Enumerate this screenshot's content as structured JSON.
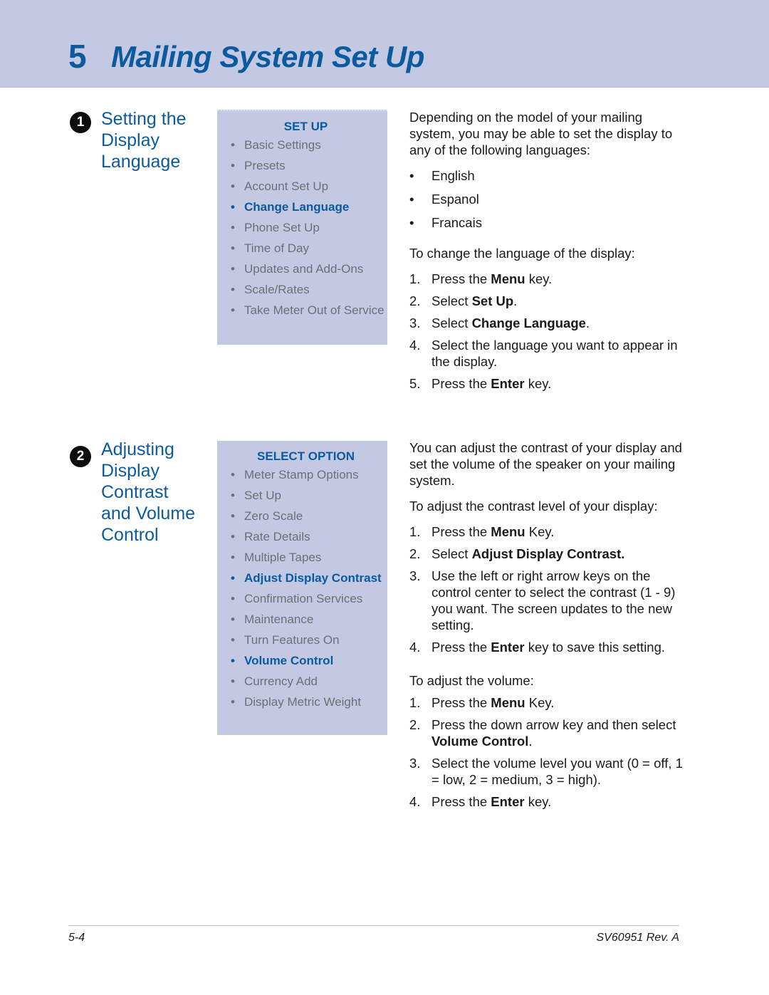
{
  "header": {
    "chapter_number": "5",
    "chapter_title": "Mailing System Set Up"
  },
  "colors": {
    "banner_bg": "#c4c9e3",
    "accent_blue": "#0b5a9e",
    "menu_gray": "#6d6f78"
  },
  "section1": {
    "badge": "1",
    "title": "Setting the Display Language",
    "menu": {
      "heading": "SET UP",
      "items": [
        {
          "label": "Basic Settings",
          "active": false
        },
        {
          "label": "Presets",
          "active": false
        },
        {
          "label": "Account Set Up",
          "active": false
        },
        {
          "label": "Change Language",
          "active": true
        },
        {
          "label": "Phone Set Up",
          "active": false
        },
        {
          "label": "Time of Day",
          "active": false
        },
        {
          "label": "Updates and Add-Ons",
          "active": false
        },
        {
          "label": "Scale/Rates",
          "active": false
        },
        {
          "label": "Take Meter Out of Service",
          "active": false
        }
      ]
    },
    "intro": "Depending on the model of your mailing system, you may be able to set the display to any of the following languages:",
    "languages": [
      "English",
      "Espanol",
      "Francais"
    ],
    "steps_intro": "To change the language of the display:",
    "steps": [
      {
        "num": "1.",
        "pre": "Press the ",
        "bold": "Menu",
        "post": " key."
      },
      {
        "num": "2.",
        "pre": "Select ",
        "bold": "Set Up",
        "post": "."
      },
      {
        "num": "3.",
        "pre": "Select ",
        "bold": "Change Language",
        "post": "."
      },
      {
        "num": "4.",
        "pre": "Select the language you want to appear in the display.",
        "bold": "",
        "post": ""
      },
      {
        "num": "5.",
        "pre": "Press the ",
        "bold": "Enter",
        "post": " key."
      }
    ]
  },
  "section2": {
    "badge": "2",
    "title": "Adjusting Display Contrast and Volume Control",
    "menu": {
      "heading": "SELECT OPTION",
      "items": [
        {
          "label": "Meter Stamp Options",
          "active": false
        },
        {
          "label": "Set Up",
          "active": false
        },
        {
          "label": "Zero Scale",
          "active": false
        },
        {
          "label": "Rate Details",
          "active": false
        },
        {
          "label": "Multiple Tapes",
          "active": false
        },
        {
          "label": "Adjust Display Contrast",
          "active": true
        },
        {
          "label": "Confirmation Services",
          "active": false
        },
        {
          "label": "Maintenance",
          "active": false
        },
        {
          "label": "Turn Features On",
          "active": false
        },
        {
          "label": "Volume Control",
          "active": true
        },
        {
          "label": "Currency Add",
          "active": false
        },
        {
          "label": "Display Metric Weight",
          "active": false
        }
      ]
    },
    "intro": "You can adjust the contrast of your display and set the volume of the speaker on your mailing system.",
    "contrast_intro": "To adjust the contrast level of your display:",
    "contrast_steps": [
      {
        "num": "1.",
        "pre": "Press the ",
        "bold": "Menu",
        "post": " Key."
      },
      {
        "num": "2.",
        "pre": "Select ",
        "bold": "Adjust Display Contrast.",
        "post": ""
      },
      {
        "num": "3.",
        "pre": "Use the left or right arrow keys on the control center to select the contrast (1 - 9) you want. The screen updates to the new setting.",
        "bold": "",
        "post": ""
      },
      {
        "num": "4.",
        "pre": "Press the ",
        "bold": "Enter",
        "post": " key to save this setting."
      }
    ],
    "volume_intro": "To adjust the volume:",
    "volume_steps": [
      {
        "num": "1.",
        "pre": "Press the ",
        "bold": "Menu",
        "post": " Key."
      },
      {
        "num": "2.",
        "pre": "Press the down arrow key and then select ",
        "bold": "Volume Control",
        "post": "."
      },
      {
        "num": "3.",
        "pre": "Select the volume level you want (0 = off, 1 = low, 2 = medium, 3 = high).",
        "bold": "",
        "post": ""
      },
      {
        "num": "4.",
        "pre": "Press the ",
        "bold": "Enter",
        "post": " key."
      }
    ]
  },
  "footer": {
    "page_number": "5-4",
    "doc_id": "SV60951 Rev. A"
  }
}
